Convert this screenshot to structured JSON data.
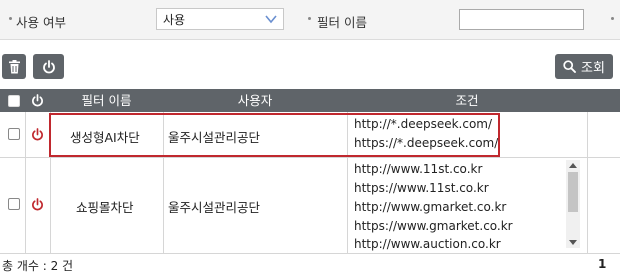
{
  "filter": {
    "use_label": "사용 여부",
    "use_value": "사용",
    "name_label": "필터 이름",
    "name_value": ""
  },
  "toolbar": {
    "search_label": "조회",
    "icons": [
      "trash-icon",
      "power-icon",
      "search-icon"
    ]
  },
  "table": {
    "columns": {
      "name": "필터 이름",
      "user": "사용자",
      "condition": "조건"
    },
    "rows": [
      {
        "name": "생성형AI차단",
        "user": "울주시설관리공단",
        "conditions": [
          "http://*.deepseek.com/",
          "https://*.deepseek.com/"
        ]
      },
      {
        "name": "쇼핑몰차단",
        "user": "울주시설관리공단",
        "conditions": [
          "http://www.11st.co.kr",
          "https://www.11st.co.kr",
          "http://www.gmarket.co.kr",
          "https://www.gmarket.co.kr",
          "http://www.auction.co.kr"
        ]
      }
    ]
  },
  "footer": {
    "total": "총 개수 : 2 건",
    "page": "1"
  },
  "colors": {
    "header_bg": "#5f6469",
    "power_red": "#c0282e",
    "highlight": "#c0282e"
  }
}
